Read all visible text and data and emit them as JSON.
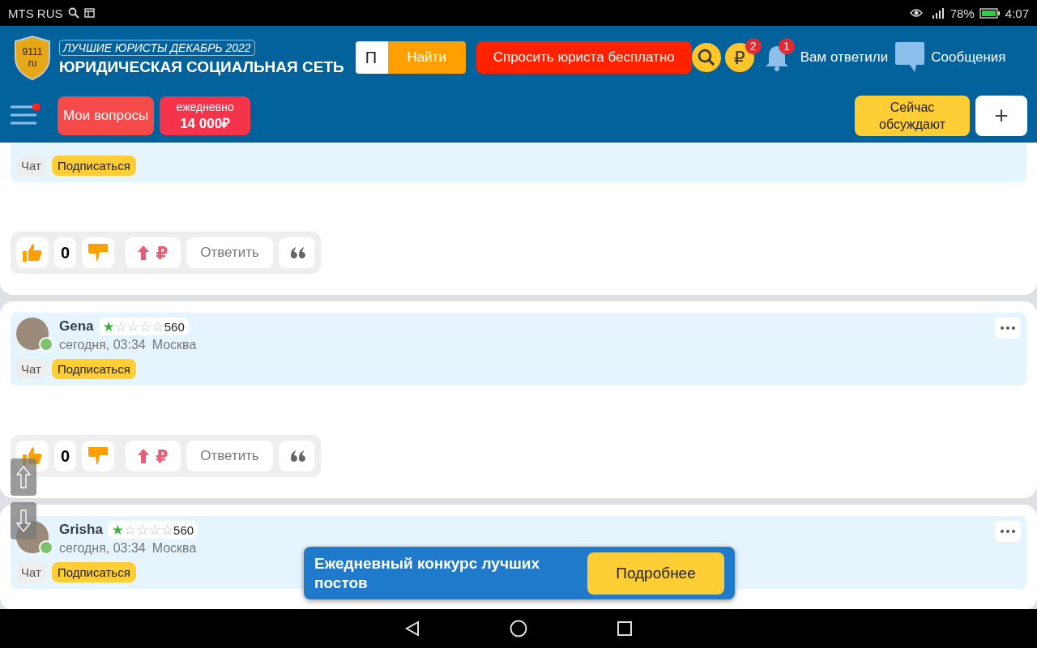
{
  "status_bar": {
    "carrier": "MTS RUS",
    "battery": "78%",
    "time": "4:07"
  },
  "header": {
    "logo": {
      "line1": "9111",
      "line2": "ru"
    },
    "promo": "ЛУЧШИЕ ЮРИСТЫ ДЕКАБРЬ 2022",
    "title": "ЮРИДИЧЕСКАЯ СОЦИАЛЬНАЯ СЕТЬ",
    "search": {
      "placeholder": "П",
      "button": "Найти"
    },
    "ask_button": "Спросить юриста бесплатно",
    "money_symbol": "₽",
    "money_badge": "2",
    "bell_badge": "1",
    "answers_link": "Вам ответили",
    "messages_link": "Сообщения",
    "menu_has_notification": true,
    "my_questions": "Мои вопросы",
    "daily": {
      "label": "ежедневно",
      "amount": "14 000₽"
    },
    "discussed_button": "Сейчас обсуждают",
    "add_button": "+"
  },
  "posts": [
    {
      "chat": "Чат",
      "subscribe": "Подписаться",
      "votes": "0",
      "ruble": "₽",
      "reply": "Ответить"
    },
    {
      "author": {
        "name": "Gena",
        "stars": 1,
        "rating": "560",
        "time": "сегодня, 03:34",
        "city": "Москва",
        "online": true
      },
      "chat": "Чат",
      "subscribe": "Подписаться",
      "votes": "0",
      "ruble": "₽",
      "reply": "Ответить"
    },
    {
      "author": {
        "name": "Grisha",
        "stars": 1,
        "rating": "560",
        "time": "сегодня, 03:34",
        "city": "Москва",
        "online": true
      },
      "chat": "Чат",
      "subscribe": "Подписаться"
    }
  ],
  "banner": {
    "text": "Ежедневный конкурс лучших постов",
    "button": "Подробнее"
  }
}
